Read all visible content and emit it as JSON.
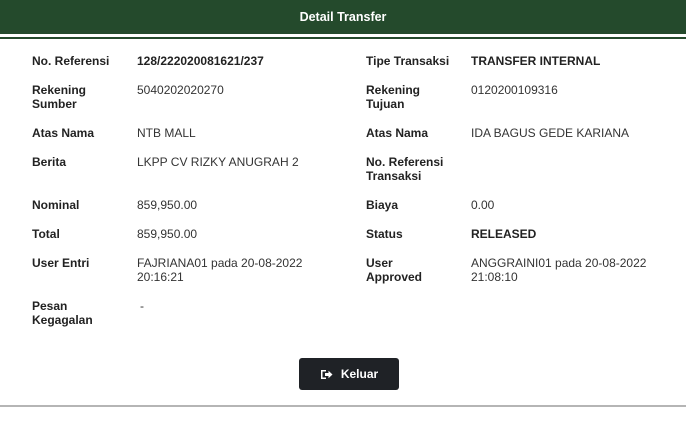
{
  "header": {
    "title": "Detail Transfer"
  },
  "fields_left": [
    {
      "label": "No. Referensi",
      "value": "128/222020081621/237",
      "bold": true
    },
    {
      "label": "Rekening Sumber",
      "value": "5040202020270",
      "bold": false
    },
    {
      "label": "Atas Nama",
      "value": "NTB MALL",
      "bold": false
    },
    {
      "label": "Berita",
      "value": "LKPP CV RIZKY ANUGRAH 2",
      "bold": false
    },
    {
      "label": "Nominal",
      "value": "859,950.00",
      "bold": false
    },
    {
      "label": "Total",
      "value": "859,950.00",
      "bold": false
    },
    {
      "label": "User Entri",
      "value": "FAJRIANA01 pada 20-08-2022 20:16:21",
      "bold": false
    },
    {
      "label": "Pesan Kegagalan",
      "value": "-",
      "bold": false
    }
  ],
  "fields_right": [
    {
      "label": "Tipe Transaksi",
      "value": "TRANSFER INTERNAL",
      "bold": true
    },
    {
      "label": "Rekening Tujuan",
      "value": "0120200109316",
      "bold": false
    },
    {
      "label": "Atas Nama",
      "value": "IDA BAGUS GEDE KARIANA",
      "bold": false
    },
    {
      "label": "No. Referensi Transaksi",
      "value": "",
      "bold": false
    },
    {
      "label": "Biaya",
      "value": "0.00",
      "bold": false
    },
    {
      "label": "Status",
      "value": "RELEASED",
      "bold": true
    },
    {
      "label": "User Approved",
      "value": "ANGGRAINI01 pada 20-08-2022 21:08:10",
      "bold": false
    }
  ],
  "actions": {
    "exit_label": "Keluar",
    "exit_icon": "sign-out-icon"
  },
  "colors": {
    "header_bg": "#244a2c",
    "button_bg": "#1f2226"
  }
}
